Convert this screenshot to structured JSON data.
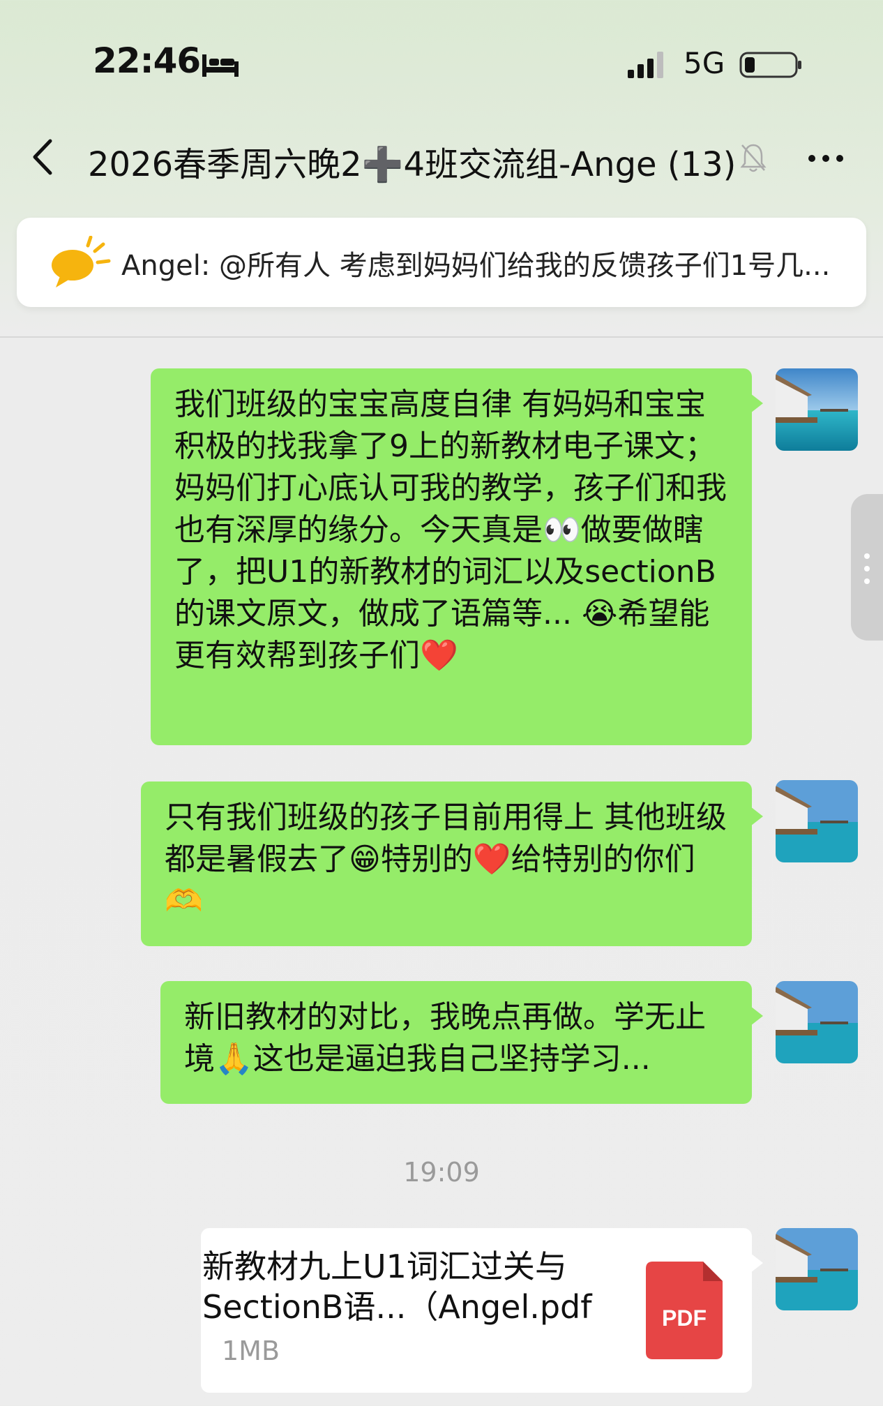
{
  "status_bar": {
    "time": "22:46",
    "network": "5G",
    "icons": [
      "bed-icon",
      "signal-icon",
      "battery-icon"
    ]
  },
  "nav": {
    "title": "2026春季周六晚2➕4班交流组-Ange (13)",
    "icons": [
      "back-icon",
      "mute-bell-icon",
      "more-icon"
    ]
  },
  "notice": {
    "text": "Angel: @所有人 考虑到妈妈们给我的反馈孩子们1号几..."
  },
  "messages": [
    {
      "type": "text",
      "text": "我们班级的宝宝高度自律 有妈妈和宝宝积极的找我拿了9上的新教材电子课文；妈妈们打心底认可我的教学，孩子们和我也有深厚的缘分。今天真是👀做要做瞎了，把U1的新教材的词汇以及sectionB的课文原文，做成了语篇等... 😭希望能更有效帮到孩子们❤️"
    },
    {
      "type": "text",
      "text": "只有我们班级的孩子目前用得上 其他班级都是暑假去了😁特别的❤️给特别的你们🫶"
    },
    {
      "type": "text",
      "text": "新旧教材的对比，我晚点再做。学无止境🙏这也是逼迫我自己坚持学习..."
    },
    {
      "type": "time",
      "text": "19:09"
    },
    {
      "type": "file",
      "name": "新教材九上U1词汇过关与SectionB语...（Angel.pdf",
      "size": "1MB",
      "icon_label": "PDF"
    }
  ],
  "colors": {
    "bubble_green": "#95ec69",
    "pdf_red": "#e64545",
    "timestamp_gray": "#9a9a9a"
  }
}
